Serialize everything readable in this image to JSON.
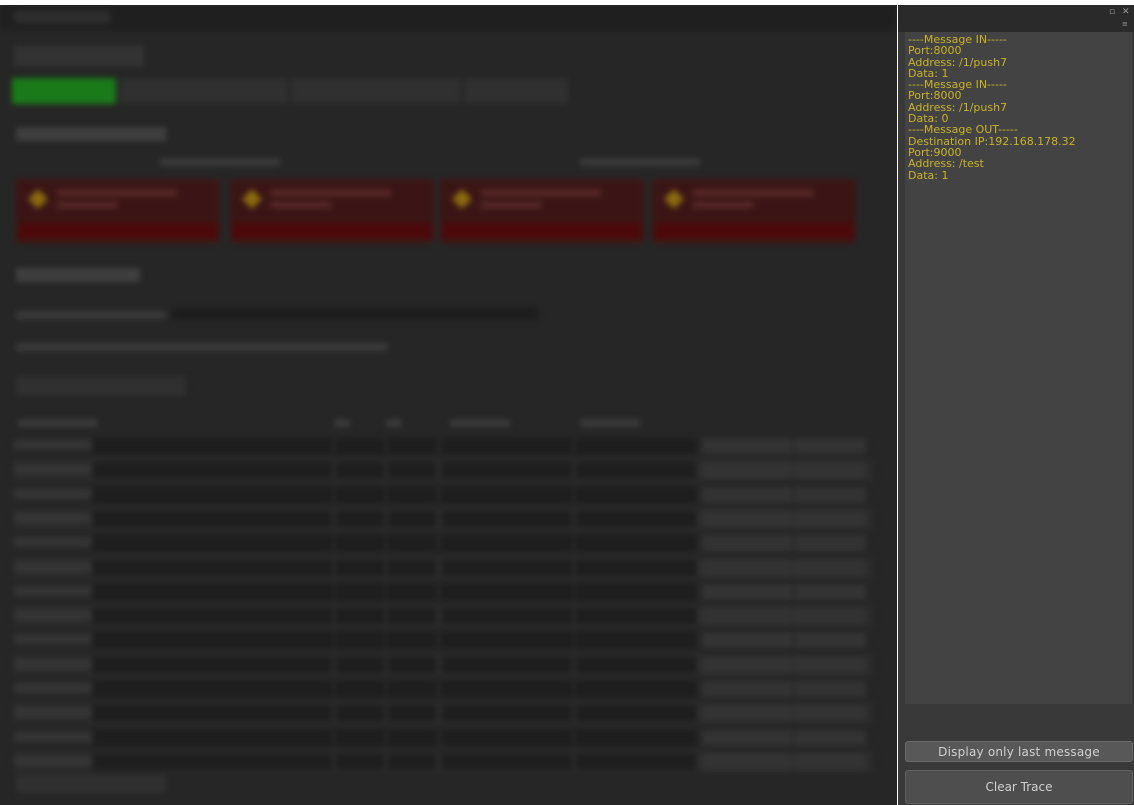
{
  "trace_panel": {
    "messages": [
      "----Message IN-----",
      "Port:8000",
      "Address: /1/push7",
      "Data: 1",
      "----Message IN-----",
      "Port:8000",
      "Address: /1/push7",
      "Data: 0",
      "----Message OUT-----",
      "Destination IP:192.168.178.32",
      "Port:9000",
      "Address: /test",
      "Data: 1"
    ],
    "display_last_label": "Display only last message",
    "clear_label": "Clear Trace",
    "text_color": "#c9b32a"
  },
  "window_controls": {
    "restore_icon": "restore-icon",
    "close_icon": "close-icon",
    "menu_icon": "menu-icon"
  }
}
